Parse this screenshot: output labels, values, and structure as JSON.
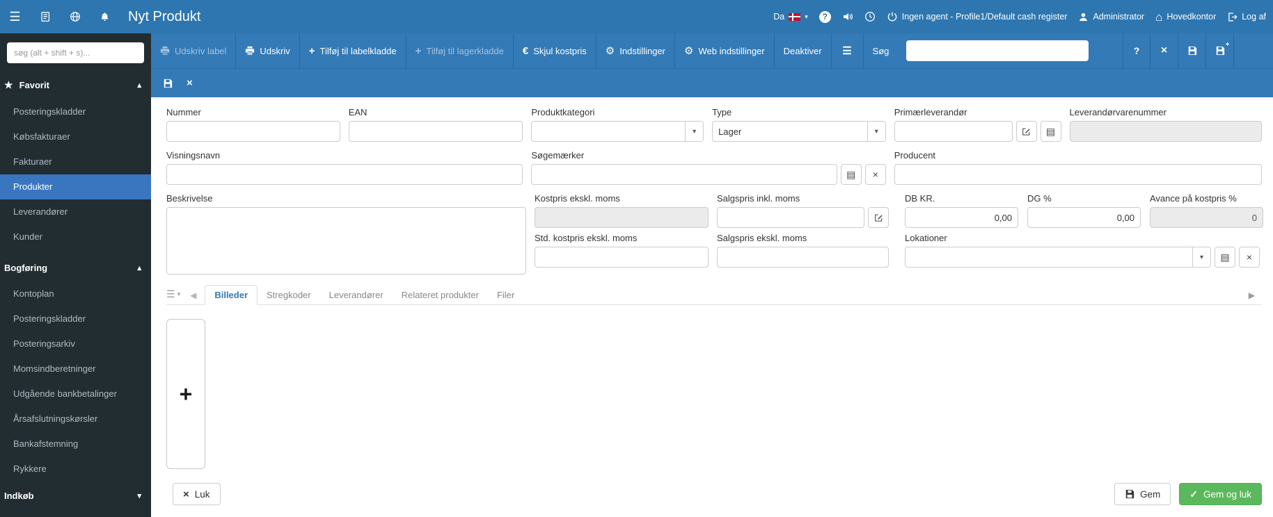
{
  "colors": {
    "topbar": "#2d76b0",
    "toolbar": "#337ab7",
    "sidebar": "#222d32",
    "sidebar_active": "#3a76c0",
    "success": "#5cb85c",
    "flag_red": "#c8102e"
  },
  "icons": {
    "hamburger": "☰",
    "star": "★",
    "caret_up": "▴",
    "caret_down": "▾",
    "select_caret": "▾",
    "tab_prev": "◀",
    "tab_next": "▶",
    "gear": "⚙",
    "euro": "€",
    "question": "?",
    "close": "×",
    "check": "✓",
    "plus": "+",
    "home": "⌂",
    "list": "▤"
  },
  "topbar": {
    "title": "Nyt Produkt",
    "language_label": "Da",
    "agent_label": "Ingen agent - Profile1/Default cash register",
    "user_label": "Administrator",
    "office_label": "Hovedkontor",
    "logout_label": "Log af"
  },
  "sidebar": {
    "search_placeholder": "søg (alt + shift + s)...",
    "sections": [
      {
        "label": "Favorit",
        "items": [
          "Posteringskladder",
          "Købsfakturaer",
          "Fakturaer",
          "Produkter",
          "Leverandører",
          "Kunder"
        ]
      },
      {
        "label": "Bogføring",
        "items": [
          "Kontoplan",
          "Posteringskladder",
          "Posteringsarkiv",
          "Momsindberetninger",
          "Udgående bankbetalinger",
          "Årsafslutningskørsler",
          "Bankafstemning",
          "Rykkere"
        ]
      },
      {
        "label": "Indkøb",
        "items": []
      }
    ],
    "active_item": "Produkter"
  },
  "toolbar": {
    "udskriv_label": "Udskriv label",
    "udskriv": "Udskriv",
    "tilfoej_labelkladde": "Tilføj til labelkladde",
    "tilfoej_lagerkladde": "Tilføj til lagerkladde",
    "skjul_kostpris": "Skjul kostpris",
    "indstillinger": "Indstillinger",
    "web_indstillinger": "Web indstillinger",
    "deaktiver": "Deaktiver",
    "soeg_label": "Søg",
    "search_value": ""
  },
  "form": {
    "nummer": {
      "label": "Nummer",
      "value": ""
    },
    "ean": {
      "label": "EAN",
      "value": ""
    },
    "produktkategori": {
      "label": "Produktkategori",
      "value": ""
    },
    "type": {
      "label": "Type",
      "value": "Lager"
    },
    "primaerleverandoer": {
      "label": "Primærleverandør",
      "value": ""
    },
    "leverandoervarenummer": {
      "label": "Leverandørvarenummer",
      "value": ""
    },
    "visningsnavn": {
      "label": "Visningsnavn",
      "value": ""
    },
    "soegemaerker": {
      "label": "Søgemærker",
      "value": ""
    },
    "producent": {
      "label": "Producent",
      "value": ""
    },
    "beskrivelse": {
      "label": "Beskrivelse",
      "value": ""
    },
    "kostpris": {
      "label": "Kostpris ekskl. moms",
      "value": ""
    },
    "salgspris_inkl": {
      "label": "Salgspris inkl. moms",
      "value": ""
    },
    "db_kr": {
      "label": "DB KR.",
      "value": "0,00"
    },
    "dg_pct": {
      "label": "DG %",
      "value": "0,00"
    },
    "avance": {
      "label": "Avance på kostpris %",
      "value": "0"
    },
    "std_kostpris": {
      "label": "Std. kostpris ekskl. moms",
      "value": ""
    },
    "salgspris_ekskl": {
      "label": "Salgspris ekskl. moms",
      "value": ""
    },
    "lokationer": {
      "label": "Lokationer",
      "value": ""
    }
  },
  "tabs": {
    "items": [
      "Billeder",
      "Stregkoder",
      "Leverandører",
      "Relateret produkter",
      "Filer"
    ],
    "active": "Billeder"
  },
  "footer": {
    "luk": "Luk",
    "gem": "Gem",
    "gem_og_luk": "Gem og luk"
  }
}
